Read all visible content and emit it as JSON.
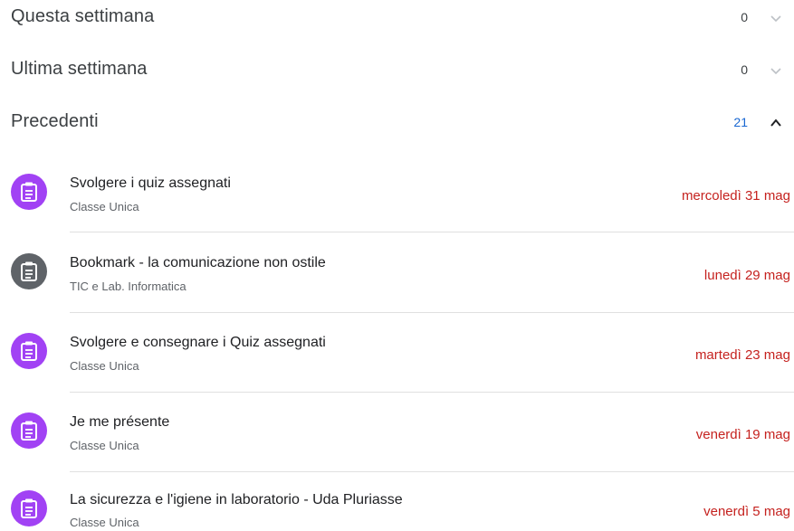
{
  "sections": [
    {
      "title": "Questa settimana",
      "count": "0",
      "expanded": false
    },
    {
      "title": "Ultima settimana",
      "count": "0",
      "expanded": false
    },
    {
      "title": "Precedenti",
      "count": "21",
      "expanded": true
    }
  ],
  "colors": {
    "icon_purple": "#a142f4",
    "icon_gray": "#5f6368",
    "date_red": "#c5221f",
    "count_blue": "#1967d2"
  },
  "items": [
    {
      "title": "Svolgere i quiz assegnati",
      "course": "Classe Unica",
      "date": "mercoledì 31 mag",
      "icon": "assignment-icon",
      "icon_color": "#a142f4"
    },
    {
      "title": "Bookmark - la comunicazione non ostile",
      "course": "TIC e Lab. Informatica",
      "date": "lunedì 29 mag",
      "icon": "assignment-icon",
      "icon_color": "#5f6368"
    },
    {
      "title": "Svolgere e consegnare i Quiz assegnati",
      "course": "Classe Unica",
      "date": "martedì 23 mag",
      "icon": "assignment-icon",
      "icon_color": "#a142f4"
    },
    {
      "title": "Je me présente",
      "course": "Classe Unica",
      "date": "venerdì 19 mag",
      "icon": "assignment-icon",
      "icon_color": "#a142f4"
    },
    {
      "title": "La sicurezza e l'igiene in laboratorio - Uda Pluriasse",
      "course": "Classe Unica",
      "date": "venerdì 5 mag",
      "icon": "assignment-icon",
      "icon_color": "#a142f4"
    }
  ]
}
